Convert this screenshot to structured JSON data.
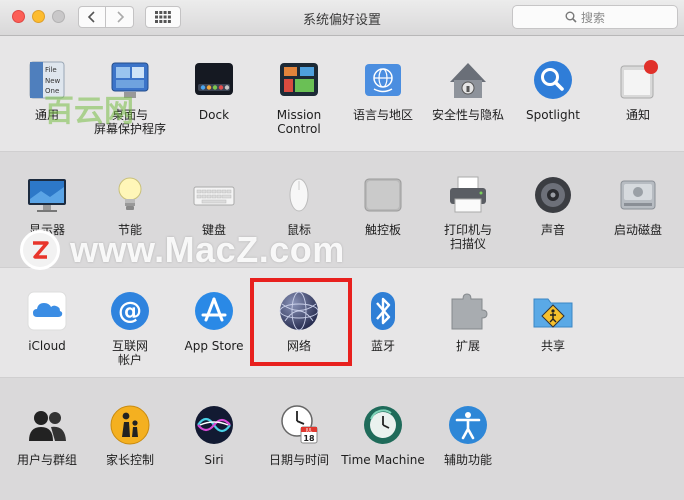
{
  "window": {
    "title": "系统偏好设置"
  },
  "search": {
    "placeholder": "搜索"
  },
  "rows": [
    [
      {
        "label": "通用",
        "icon": "general-icon"
      },
      {
        "label": "桌面与\n屏幕保护程序",
        "icon": "desktop-screensaver-icon"
      },
      {
        "label": "Dock",
        "icon": "dock-icon"
      },
      {
        "label": "Mission\nControl",
        "icon": "mission-control-icon"
      },
      {
        "label": "语言与地区",
        "icon": "language-region-icon"
      },
      {
        "label": "安全性与隐私",
        "icon": "security-privacy-icon"
      },
      {
        "label": "Spotlight",
        "icon": "spotlight-icon"
      },
      {
        "label": "通知",
        "icon": "notifications-icon"
      }
    ],
    [
      {
        "label": "显示器",
        "icon": "displays-icon"
      },
      {
        "label": "节能",
        "icon": "energy-saver-icon"
      },
      {
        "label": "键盘",
        "icon": "keyboard-icon"
      },
      {
        "label": "鼠标",
        "icon": "mouse-icon"
      },
      {
        "label": "触控板",
        "icon": "trackpad-icon"
      },
      {
        "label": "打印机与\n扫描仪",
        "icon": "printer-scanner-icon"
      },
      {
        "label": "声音",
        "icon": "sound-icon"
      },
      {
        "label": "启动磁盘",
        "icon": "startup-disk-icon"
      }
    ],
    [
      {
        "label": "iCloud",
        "icon": "icloud-icon"
      },
      {
        "label": "互联网\n帐户",
        "icon": "internet-accounts-icon"
      },
      {
        "label": "App Store",
        "icon": "app-store-icon"
      },
      {
        "label": "网络",
        "icon": "network-icon"
      },
      {
        "label": "蓝牙",
        "icon": "bluetooth-icon"
      },
      {
        "label": "扩展",
        "icon": "extensions-icon"
      },
      {
        "label": "共享",
        "icon": "sharing-icon"
      }
    ],
    [
      {
        "label": "用户与群组",
        "icon": "users-groups-icon"
      },
      {
        "label": "家长控制",
        "icon": "parental-controls-icon"
      },
      {
        "label": "Siri",
        "icon": "siri-icon"
      },
      {
        "label": "日期与时间",
        "icon": "date-time-icon"
      },
      {
        "label": "Time Machine",
        "icon": "time-machine-icon"
      },
      {
        "label": "辅助功能",
        "icon": "accessibility-icon"
      }
    ]
  ],
  "watermark": {
    "text": "www.MacZ.com",
    "logo": "Z",
    "overlay_text": "百云网"
  },
  "icon_texts": {
    "general_file": "File",
    "general_new": "New",
    "general_one": "One",
    "calendar_day": "18",
    "calendar_month": "JUL"
  },
  "colors": {
    "highlight": "#e8201e",
    "close": "#fc5f57",
    "minimize": "#fdbc2e"
  }
}
